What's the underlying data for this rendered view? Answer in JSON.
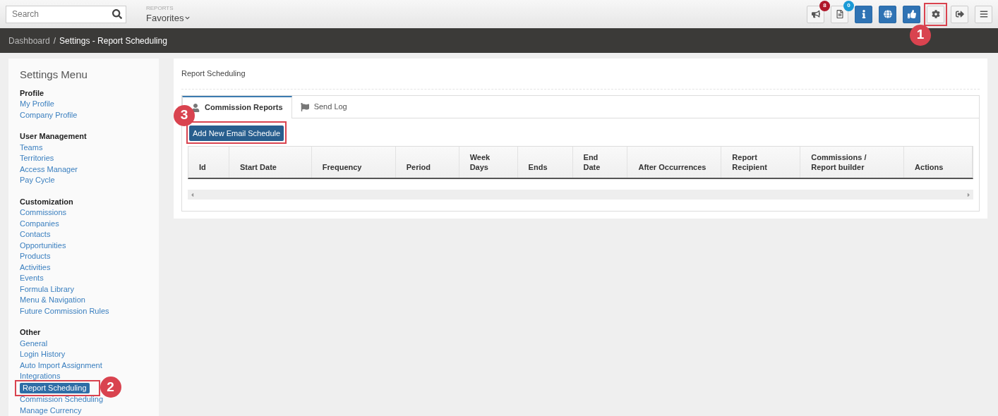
{
  "search": {
    "placeholder": "Search"
  },
  "reports_menu": {
    "caption": "REPORTS",
    "label": "Favorites"
  },
  "toolbar": [
    {
      "kind": "plain",
      "badge": {
        "count": "8",
        "color": "#b0182a"
      },
      "highlighted": false
    },
    {
      "kind": "plain",
      "badge": {
        "count": "0",
        "color": "#1a9ad6"
      },
      "highlighted": false
    },
    {
      "kind": "primary",
      "highlighted": false
    },
    {
      "kind": "primary",
      "highlighted": false
    },
    {
      "kind": "primary",
      "highlighted": false
    },
    {
      "kind": "plain",
      "highlighted": true,
      "step": "1"
    },
    {
      "kind": "plain",
      "highlighted": false
    },
    {
      "kind": "plain",
      "highlighted": false
    }
  ],
  "breadcrumb": {
    "separator": "/",
    "items": [
      {
        "label": "Dashboard",
        "current": false
      },
      {
        "label": "Settings - Report Scheduling",
        "current": true
      }
    ]
  },
  "sidebar": {
    "title": "Settings Menu",
    "sections": [
      {
        "heading": "Profile",
        "items": [
          {
            "label": "My Profile",
            "selected": false
          },
          {
            "label": "Company Profile",
            "selected": false
          }
        ]
      },
      {
        "heading": "User Management",
        "items": [
          {
            "label": "Teams",
            "selected": false
          },
          {
            "label": "Territories",
            "selected": false
          },
          {
            "label": "Access Manager",
            "selected": false
          },
          {
            "label": "Pay Cycle",
            "selected": false
          }
        ]
      },
      {
        "heading": "Customization",
        "items": [
          {
            "label": "Commissions",
            "selected": false
          },
          {
            "label": "Companies",
            "selected": false
          },
          {
            "label": "Contacts",
            "selected": false
          },
          {
            "label": "Opportunities",
            "selected": false
          },
          {
            "label": "Products",
            "selected": false
          },
          {
            "label": "Activities",
            "selected": false
          },
          {
            "label": "Events",
            "selected": false
          },
          {
            "label": "Formula Library",
            "selected": false
          },
          {
            "label": "Menu & Navigation",
            "selected": false
          },
          {
            "label": "Future Commission Rules",
            "selected": false
          }
        ]
      },
      {
        "heading": "Other",
        "items": [
          {
            "label": "General",
            "selected": false
          },
          {
            "label": "Login History",
            "selected": false
          },
          {
            "label": "Auto Import Assignment",
            "selected": false
          },
          {
            "label": "Integrations",
            "selected": false
          },
          {
            "label": "Report Scheduling",
            "selected": true,
            "step": "2"
          },
          {
            "label": "Commission Scheduling",
            "selected": false
          },
          {
            "label": "Manage Currency",
            "selected": false
          }
        ]
      }
    ]
  },
  "panel": {
    "title": "Report Scheduling",
    "tabs": [
      {
        "label": "Commission Reports",
        "selected": true
      },
      {
        "label": "Send Log",
        "selected": false
      }
    ],
    "add_button": {
      "label": "Add New Email Schedule",
      "step": "3"
    },
    "table": {
      "columns": [
        "Id",
        "Start Date",
        "Frequency",
        "Period",
        "Week Days",
        "Ends",
        "End Date",
        "After Occurrences",
        "Report Recipient",
        "Commissions / Report builder",
        "Actions"
      ]
    }
  }
}
